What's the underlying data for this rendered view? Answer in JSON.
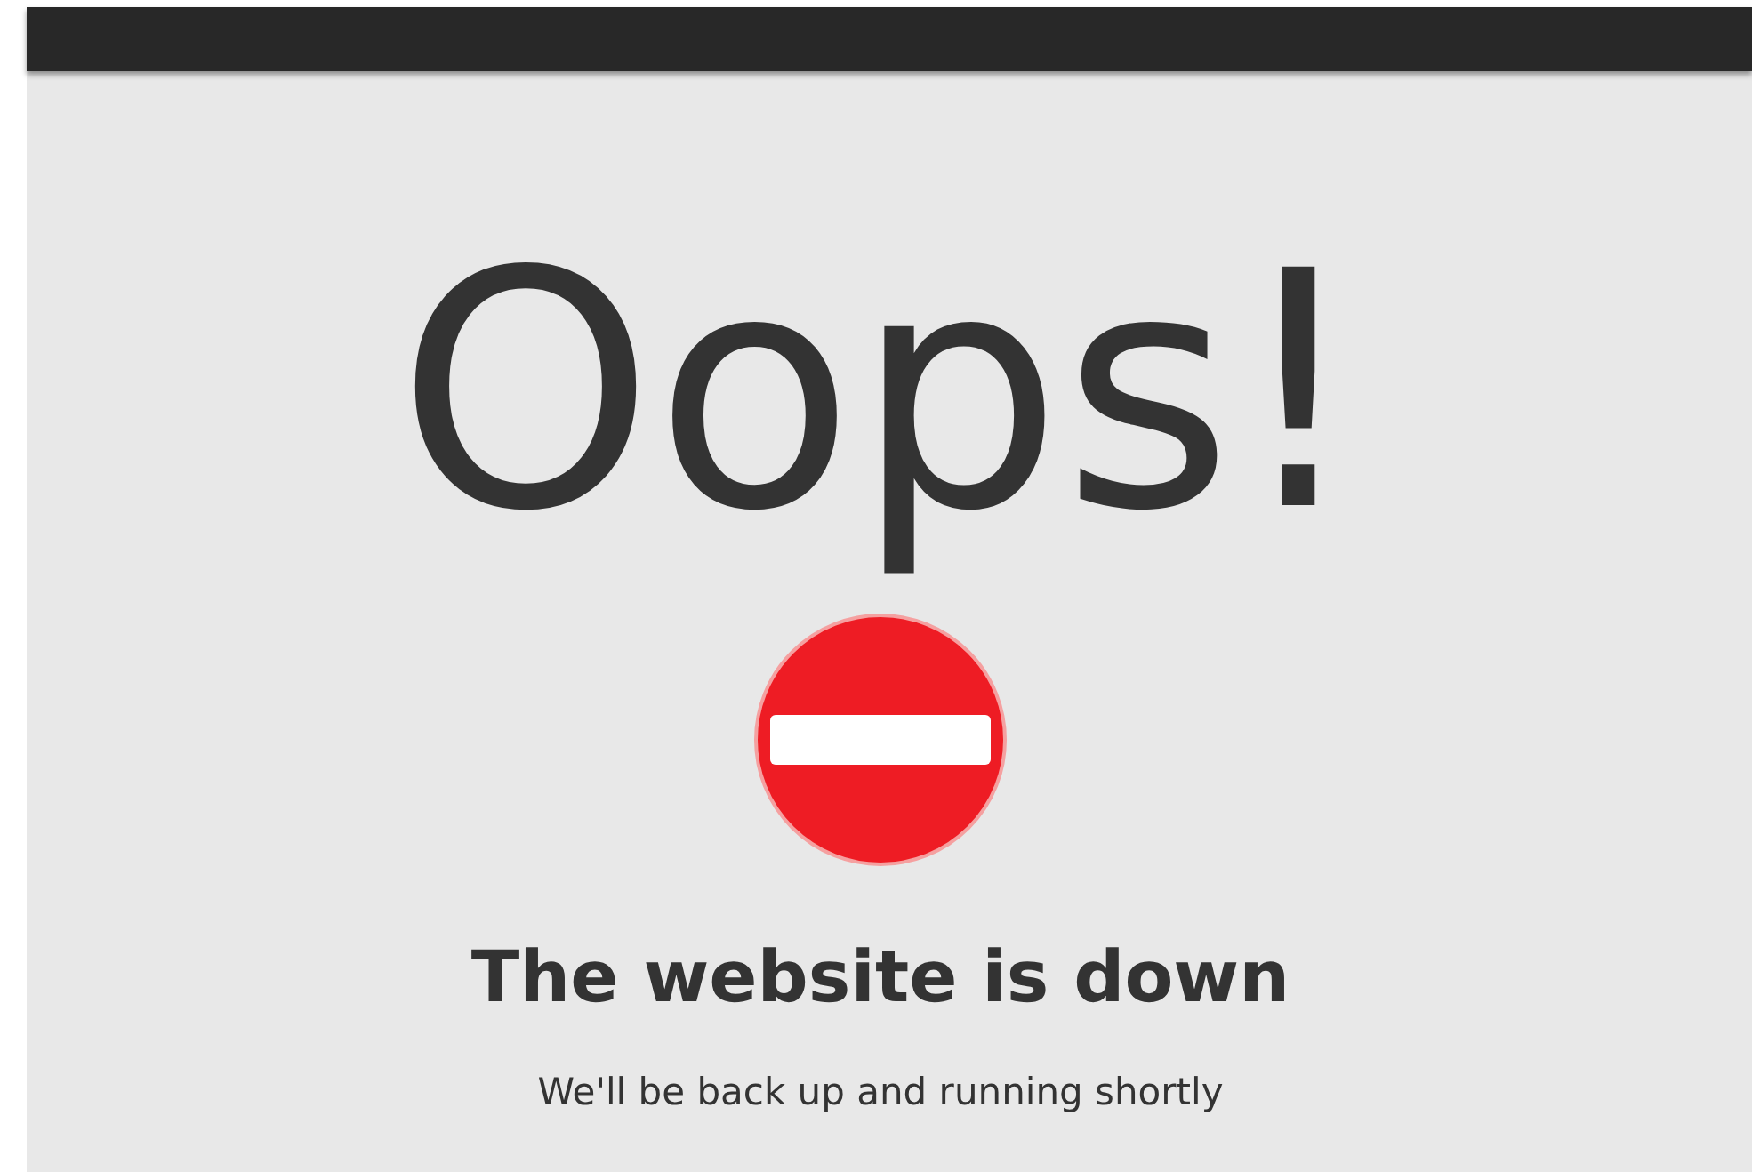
{
  "title": "Oops!",
  "heading": "The website is down",
  "message": "We'll be back up and running shortly"
}
